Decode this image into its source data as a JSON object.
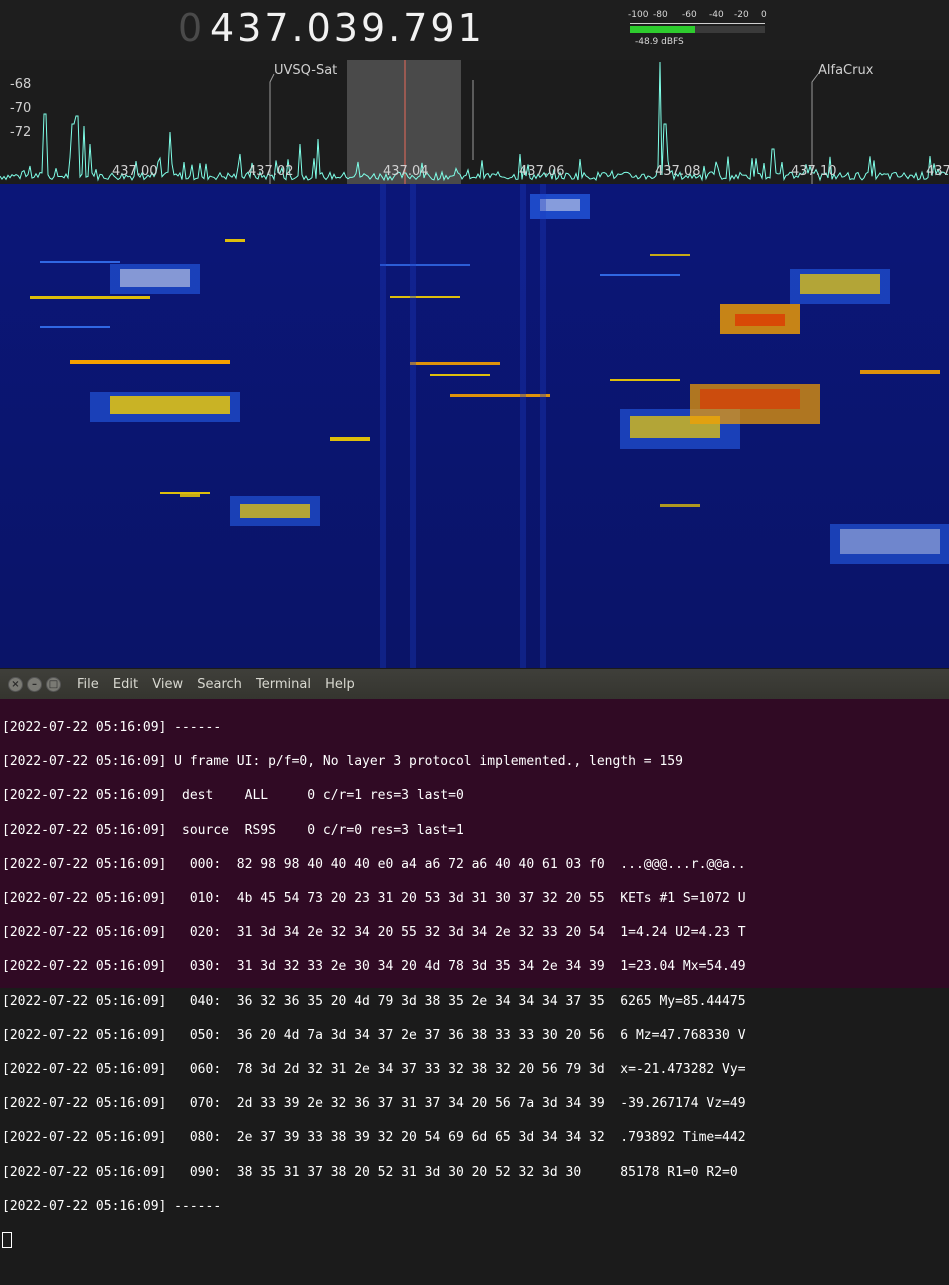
{
  "sdr": {
    "frequency_lead": "0",
    "frequency": "437.039.791",
    "meter": {
      "ticks": [
        "-100",
        "-80",
        "-60",
        "-40",
        "-20",
        "0"
      ],
      "level_fraction": 0.48,
      "readout": "-48.9 dBFS",
      "bar_color": "#2ecc2e"
    },
    "spectrum": {
      "db_labels": [
        "-68",
        "-70",
        "-72"
      ],
      "freq_labels": [
        "437.00",
        "437.02",
        "437.04",
        "437.06",
        "437.08",
        "437.10",
        "437"
      ],
      "markers": [
        "UVSQ-Sat",
        "AlfaCrux"
      ],
      "trace_color": "#7fffe8",
      "tuned_line_color": "#e86a5a"
    },
    "waterfall": {
      "background": "#0a1470"
    }
  },
  "terminal": {
    "menu": [
      "File",
      "Edit",
      "View",
      "Search",
      "Terminal",
      "Help"
    ],
    "lines": [
      "[2022-07-22 05:16:09] ------",
      "[2022-07-22 05:16:09] U frame UI: p/f=0, No layer 3 protocol implemented., length = 159",
      "[2022-07-22 05:16:09]  dest    ALL     0 c/r=1 res=3 last=0",
      "[2022-07-22 05:16:09]  source  RS9S    0 c/r=0 res=3 last=1",
      "[2022-07-22 05:16:09]   000:  82 98 98 40 40 40 e0 a4 a6 72 a6 40 40 61 03 f0  ...@@@...r.@@a..",
      "[2022-07-22 05:16:09]   010:  4b 45 54 73 20 23 31 20 53 3d 31 30 37 32 20 55  KETs #1 S=1072 U",
      "[2022-07-22 05:16:09]   020:  31 3d 34 2e 32 34 20 55 32 3d 34 2e 32 33 20 54  1=4.24 U2=4.23 T",
      "[2022-07-22 05:16:09]   030:  31 3d 32 33 2e 30 34 20 4d 78 3d 35 34 2e 34 39  1=23.04 Mx=54.49",
      "[2022-07-22 05:16:09]   040:  36 32 36 35 20 4d 79 3d 38 35 2e 34 34 34 37 35  6265 My=85.44475",
      "[2022-07-22 05:16:09]   050:  36 20 4d 7a 3d 34 37 2e 37 36 38 33 33 30 20 56  6 Mz=47.768330 V",
      "[2022-07-22 05:16:09]   060:  78 3d 2d 32 31 2e 34 37 33 32 38 32 20 56 79 3d  x=-21.473282 Vy=",
      "[2022-07-22 05:16:09]   070:  2d 33 39 2e 32 36 37 31 37 34 20 56 7a 3d 34 39  -39.267174 Vz=49",
      "[2022-07-22 05:16:09]   080:  2e 37 39 33 38 39 32 20 54 69 6d 65 3d 34 34 32  .793892 Time=442",
      "[2022-07-22 05:16:09]   090:  38 35 31 37 38 20 52 31 3d 30 20 52 32 3d 30     85178 R1=0 R2=0",
      "[2022-07-22 05:16:09] ------"
    ]
  }
}
